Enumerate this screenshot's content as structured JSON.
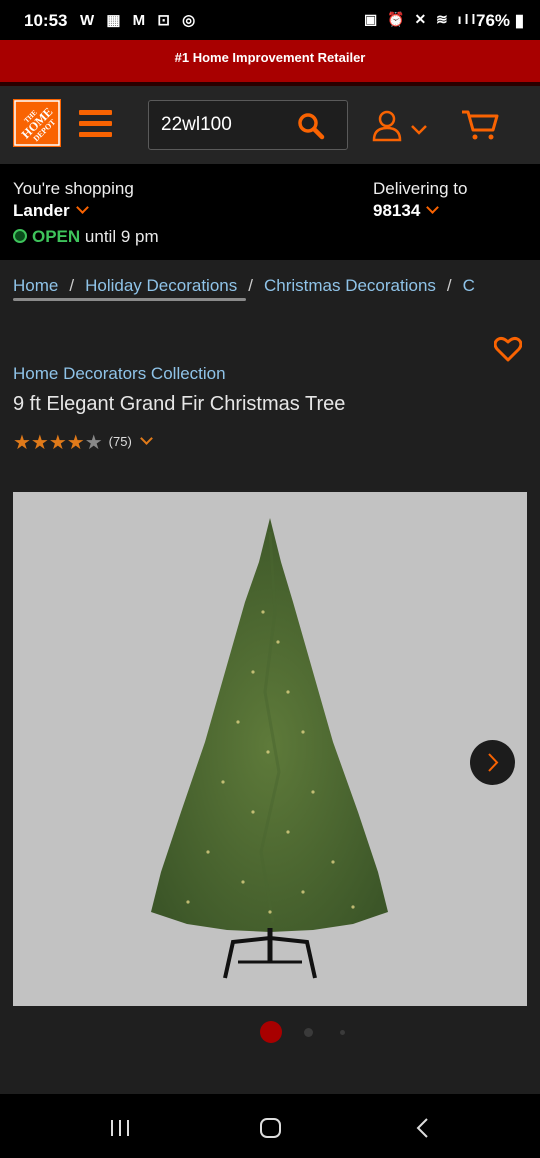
{
  "status_bar": {
    "time": "10:53",
    "battery": "76%"
  },
  "promo": {
    "text": "#1 Home Improvement Retailer"
  },
  "header": {
    "logo_text": "THE HOME DEPOT",
    "search_value": "22wl100"
  },
  "store": {
    "shopping_label": "You're shopping",
    "store_name": "Lander",
    "open_label": "OPEN",
    "hours": "until 9 pm",
    "delivering_label": "Delivering to",
    "zip": "98134"
  },
  "breadcrumb": {
    "items": [
      "Home",
      "Holiday Decorations",
      "Christmas Decorations",
      "C"
    ]
  },
  "product": {
    "brand": "Home Decorators Collection",
    "title": "9 ft Elegant Grand Fir Christmas Tree",
    "rating": 4.5,
    "stars": "★★★★",
    "stars_empty": "★",
    "review_count": "(75)"
  },
  "gallery": {
    "active_index": 0,
    "total_dots": 3
  },
  "colors": {
    "accent": "#f96302",
    "promo": "#a80000",
    "link": "#8fc3e8",
    "open": "#3ec35b"
  },
  "icons": [
    "menu-icon",
    "search-icon",
    "account-icon",
    "cart-icon",
    "heart-icon",
    "chevron-right-icon",
    "recents-icon",
    "home-icon",
    "back-icon"
  ]
}
